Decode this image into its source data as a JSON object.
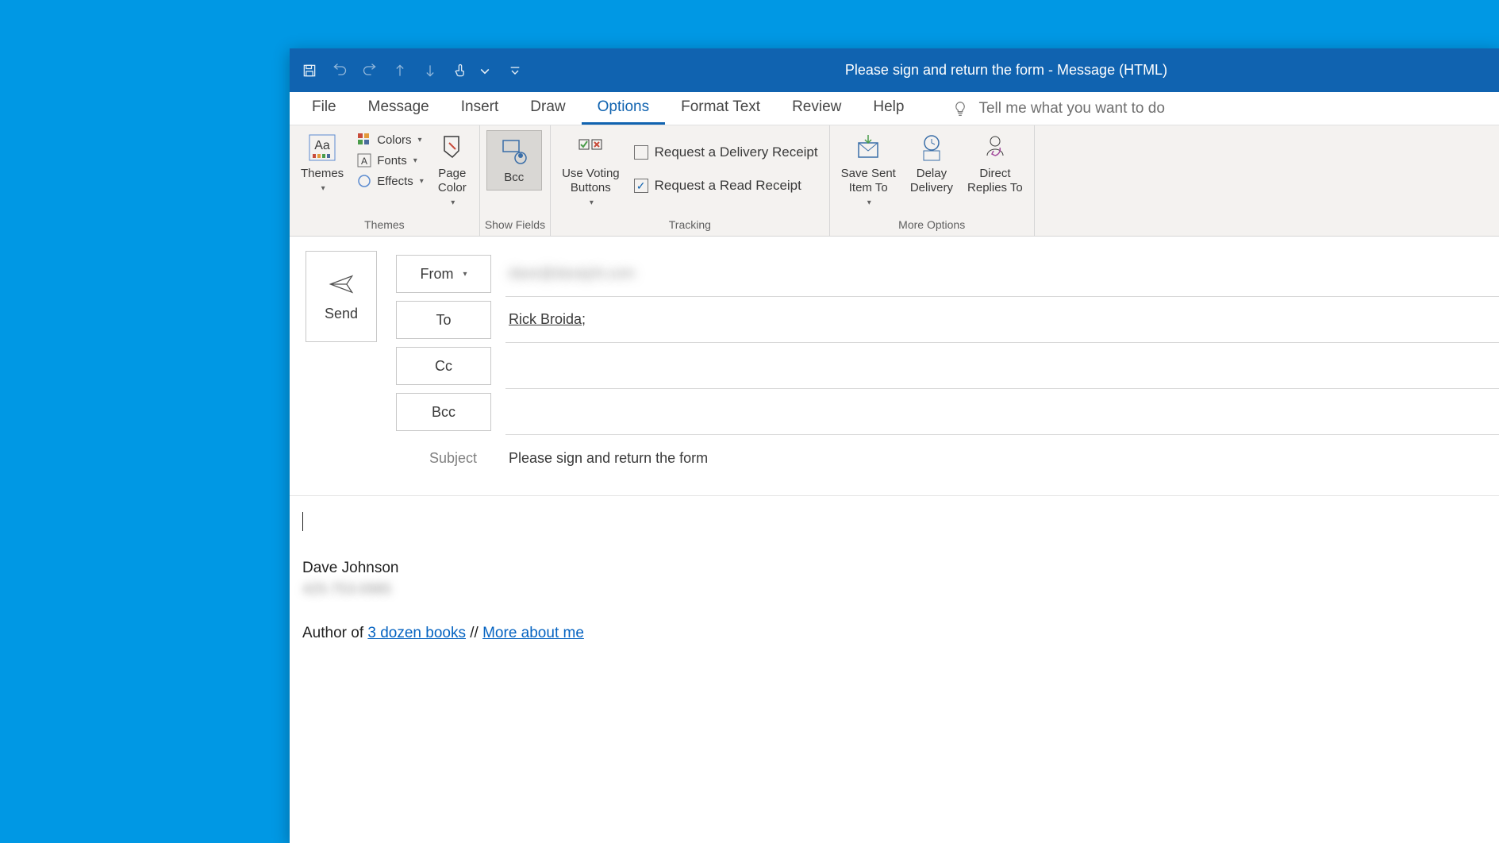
{
  "title": "Please sign and return the form  -  Message (HTML)",
  "menus": {
    "file": "File",
    "message": "Message",
    "insert": "Insert",
    "draw": "Draw",
    "options": "Options",
    "format": "Format Text",
    "review": "Review",
    "help": "Help"
  },
  "tellme": "Tell me what you want to do",
  "ribbon": {
    "themes": {
      "label": "Themes",
      "themes_btn": "Themes",
      "colors": "Colors",
      "fonts": "Fonts",
      "effects": "Effects",
      "pagecolor": "Page\nColor"
    },
    "showfields": {
      "label": "Show Fields",
      "bcc": "Bcc"
    },
    "tracking": {
      "label": "Tracking",
      "voting": "Use Voting\nButtons",
      "delivery": "Request a Delivery Receipt",
      "read": "Request a Read Receipt"
    },
    "more": {
      "label": "More Options",
      "savesent": "Save Sent\nItem To",
      "delay": "Delay\nDelivery",
      "direct": "Direct\nReplies To"
    }
  },
  "header": {
    "send": "Send",
    "from_btn": "From",
    "from_val": "dave@davejoh.com",
    "to_btn": "To",
    "to_val": "Rick Broida",
    "cc_btn": "Cc",
    "bcc_btn": "Bcc",
    "subject_lbl": "Subject",
    "subject_val": "Please sign and return the form"
  },
  "body": {
    "sig_name": "Dave Johnson",
    "sig_phone": "425-753-0985",
    "sig_prefix": "Author of ",
    "sig_link1": "3 dozen books",
    "sig_sep": " // ",
    "sig_link2": "More about me"
  }
}
